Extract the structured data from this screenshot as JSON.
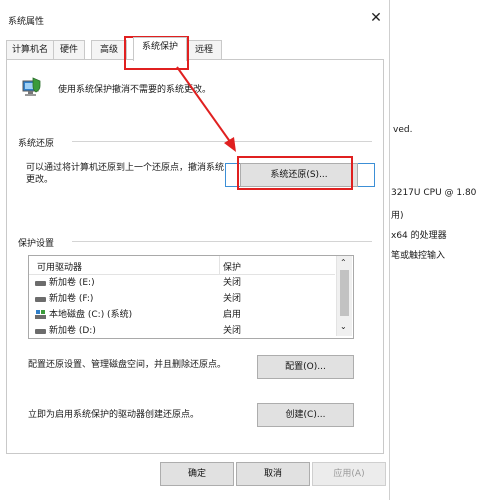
{
  "dialog": {
    "title": "系统属性",
    "close_symbol": "✕"
  },
  "tabs": [
    {
      "label": "计算机名"
    },
    {
      "label": "硬件"
    },
    {
      "label": "高级"
    },
    {
      "label": "系统保护"
    },
    {
      "label": "远程"
    }
  ],
  "intro_text": "使用系统保护撤消不需要的系统更改。",
  "restore_group": {
    "title": "系统还原",
    "description": "可以通过将计算机还原到上一个还原点，撤消系统更改。",
    "button_label": "系统还原(S)..."
  },
  "protection_group": {
    "title": "保护设置",
    "columns": [
      "可用驱动器",
      "保护"
    ],
    "drives": [
      {
        "name": "新加卷 (E:)",
        "status": "关闭",
        "icon": "drive-icon"
      },
      {
        "name": "新加卷 (F:)",
        "status": "关闭",
        "icon": "drive-icon"
      },
      {
        "name": "本地磁盘 (C:) (系统)",
        "status": "启用",
        "icon": "system-drive-icon"
      },
      {
        "name": "新加卷 (D:)",
        "status": "关闭",
        "icon": "drive-icon"
      }
    ],
    "configure_text": "配置还原设置、管理磁盘空间，并且删除还原点。",
    "configure_button": "配置(O)...",
    "create_text": "立即为启用系统保护的驱动器创建还原点。",
    "create_button": "创建(C)..."
  },
  "footer": {
    "ok": "确定",
    "cancel": "取消",
    "apply": "应用(A)"
  },
  "background_window": {
    "lines": [
      "ved.",
      "3217U CPU @ 1.80",
      "用)",
      "x64 的处理器",
      "笔或触控输入"
    ]
  },
  "colors": {
    "annotation": "#e02020",
    "focus_border": "#3c8fd6"
  }
}
